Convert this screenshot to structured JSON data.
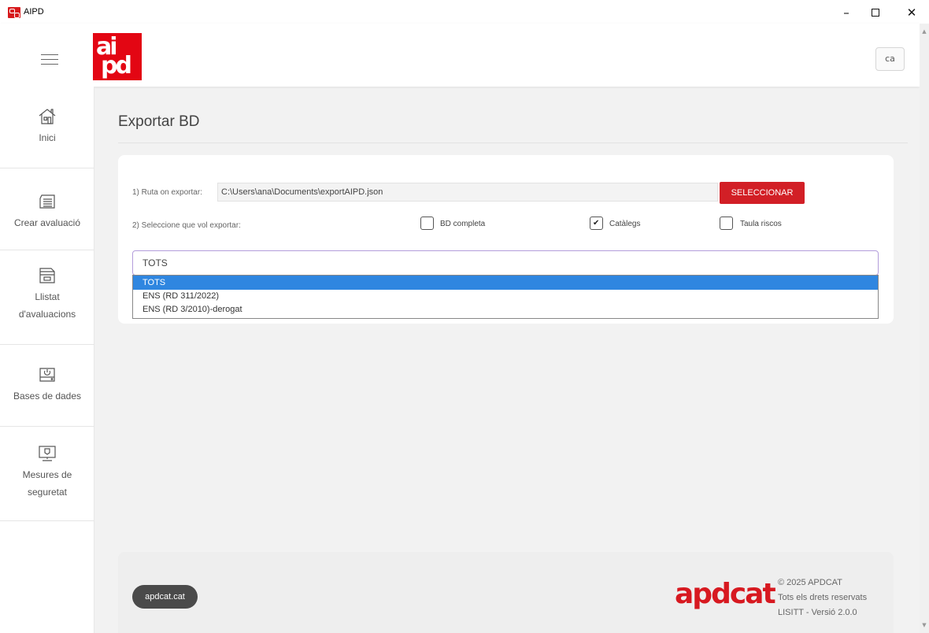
{
  "window": {
    "title": "AIPD",
    "minimize": "–",
    "close": "✕"
  },
  "header": {
    "lang": "ca",
    "logo_top": "ai",
    "logo_bottom": "pd"
  },
  "sidebar": {
    "items": [
      {
        "label": "Inici",
        "icon": "home-icon"
      },
      {
        "label": "Crear avaluació",
        "icon": "document-icon"
      },
      {
        "label": "Llistat d'avaluacions",
        "icon": "folder-list-icon"
      },
      {
        "label": "Bases de dades",
        "icon": "database-icon"
      },
      {
        "label": "Mesures de seguretat",
        "icon": "monitor-shield-icon"
      }
    ]
  },
  "main": {
    "title": "Exportar BD",
    "path_label": "1) Ruta on exportar:",
    "path_value": "C:\\Users\\ana\\Documents\\exportAIPD.json",
    "select_button": "SELECCIONAR",
    "export_label": "2) Seleccione que vol exportar:",
    "checkboxes": [
      {
        "label": "BD completa",
        "checked": false
      },
      {
        "label": "Catàlegs",
        "checked": true
      },
      {
        "label": "Taula riscos",
        "checked": false
      }
    ],
    "combo_value": "TOTS",
    "options": [
      "TOTS",
      "ENS (RD 311/2022)",
      "ENS (RD 3/2010)-derogat"
    ]
  },
  "footer": {
    "link": "apdcat.cat",
    "logo": "apdcat",
    "copyright": "© 2025 APDCAT",
    "rights": "Tots els drets reservats",
    "version": "LISITT - Versió 2.0.0"
  },
  "colors": {
    "brand_red": "#e30613",
    "selection_blue": "#2f86e0",
    "combo_border": "#b39ddb"
  }
}
